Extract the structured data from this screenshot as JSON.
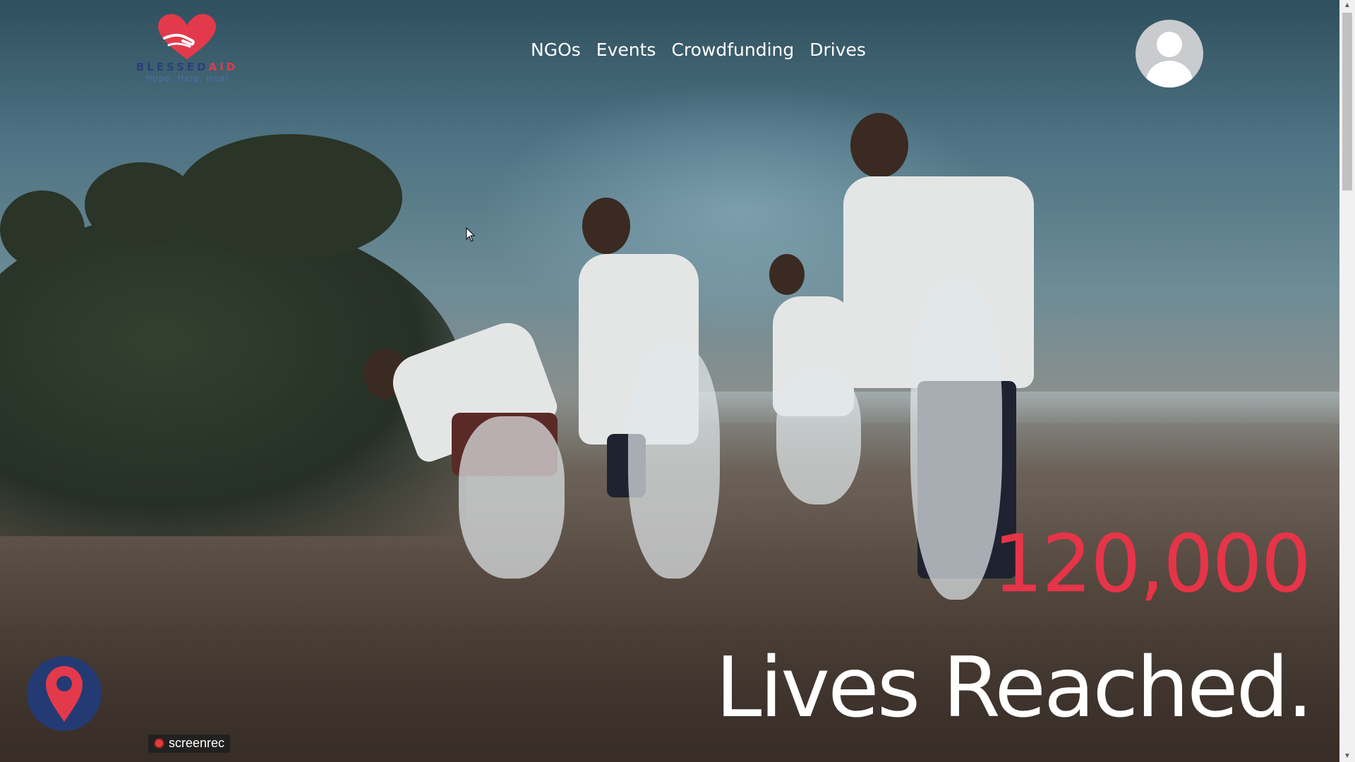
{
  "brand": {
    "name_part1": "BLESSED",
    "name_part2": "AID",
    "tagline": "Hope. Help. Heal",
    "accent_color": "#e23a4b",
    "navy_color": "#2d3f7a"
  },
  "nav": {
    "items": [
      {
        "label": "NGOs"
      },
      {
        "label": "Events"
      },
      {
        "label": "Crowdfunding"
      },
      {
        "label": "Drives"
      }
    ]
  },
  "profile": {
    "icon": "user-avatar-icon"
  },
  "hero": {
    "stat_number": "120,000",
    "stat_label": "Lives Reached.",
    "stat_color": "#e63448"
  },
  "location_button": {
    "icon": "map-pin-icon"
  },
  "recorder": {
    "label": "screenrec"
  }
}
